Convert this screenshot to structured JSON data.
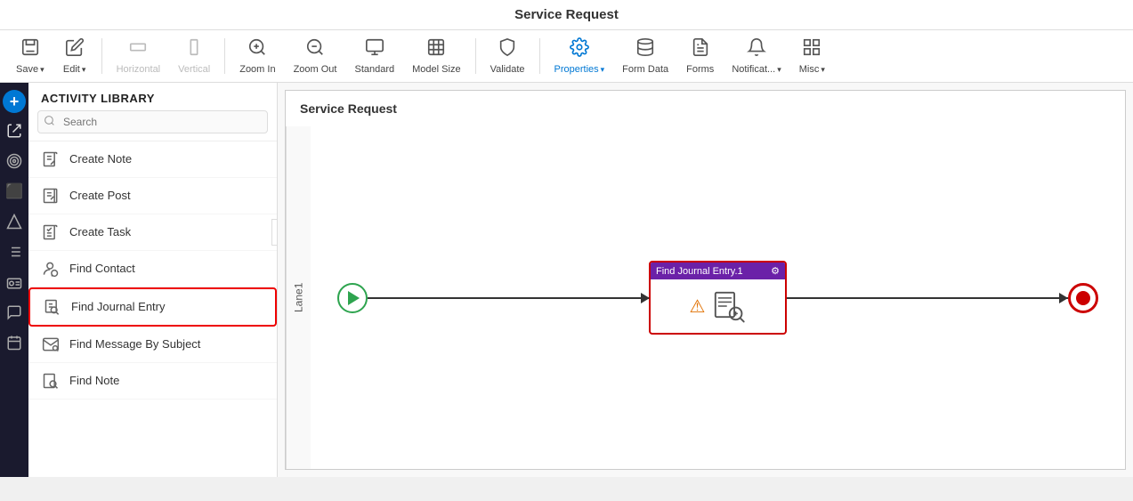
{
  "titleBar": {
    "title": "Service Request"
  },
  "toolbar": {
    "items": [
      {
        "id": "save",
        "label": "Save",
        "icon": "💾",
        "hasDropdown": true,
        "disabled": false,
        "active": false
      },
      {
        "id": "edit",
        "label": "Edit",
        "icon": "✏️",
        "hasDropdown": true,
        "disabled": false,
        "active": false
      },
      {
        "id": "horizontal",
        "label": "Horizontal",
        "icon": "⬛",
        "hasDropdown": false,
        "disabled": true,
        "active": false
      },
      {
        "id": "vertical",
        "label": "Vertical",
        "icon": "🔲",
        "hasDropdown": false,
        "disabled": true,
        "active": false
      },
      {
        "id": "zoom-in",
        "label": "Zoom In",
        "icon": "🔍",
        "hasDropdown": false,
        "disabled": false,
        "active": false
      },
      {
        "id": "zoom-out",
        "label": "Zoom Out",
        "icon": "🔎",
        "hasDropdown": false,
        "disabled": false,
        "active": false
      },
      {
        "id": "standard",
        "label": "Standard",
        "icon": "🖥",
        "hasDropdown": false,
        "disabled": false,
        "active": false
      },
      {
        "id": "model-size",
        "label": "Model Size",
        "icon": "⬜",
        "hasDropdown": false,
        "disabled": false,
        "active": false
      },
      {
        "id": "validate",
        "label": "Validate",
        "icon": "🛡",
        "hasDropdown": false,
        "disabled": false,
        "active": false
      },
      {
        "id": "properties",
        "label": "Properties",
        "icon": "⚙️",
        "hasDropdown": true,
        "disabled": false,
        "active": true
      },
      {
        "id": "form-data",
        "label": "Form Data",
        "icon": "📊",
        "hasDropdown": false,
        "disabled": false,
        "active": false
      },
      {
        "id": "forms",
        "label": "Forms",
        "icon": "📄",
        "hasDropdown": false,
        "disabled": false,
        "active": false
      },
      {
        "id": "notifications",
        "label": "Notificat...",
        "icon": "🔔",
        "hasDropdown": true,
        "disabled": false,
        "active": false
      },
      {
        "id": "misc",
        "label": "Misc",
        "icon": "🗂",
        "hasDropdown": true,
        "disabled": false,
        "active": false
      }
    ]
  },
  "iconRail": {
    "items": [
      {
        "id": "add",
        "icon": "+",
        "active": true,
        "style": "blue"
      },
      {
        "id": "exchange",
        "icon": "⇄",
        "active": false,
        "style": ""
      },
      {
        "id": "target",
        "icon": "◎",
        "active": false,
        "style": ""
      },
      {
        "id": "office",
        "icon": "⬛",
        "active": false,
        "style": "orange"
      },
      {
        "id": "drive",
        "icon": "△",
        "active": false,
        "style": ""
      },
      {
        "id": "list",
        "icon": "≡",
        "active": false,
        "style": ""
      },
      {
        "id": "id-card",
        "icon": "🪪",
        "active": false,
        "style": ""
      },
      {
        "id": "chat",
        "icon": "💬",
        "active": false,
        "style": ""
      },
      {
        "id": "calendar",
        "icon": "📅",
        "active": false,
        "style": ""
      }
    ]
  },
  "sidebar": {
    "header": "Activity Library",
    "search": {
      "placeholder": "Search"
    },
    "items": [
      {
        "id": "create-note",
        "label": "Create Note",
        "icon": "note",
        "selected": false
      },
      {
        "id": "create-post",
        "label": "Create Post",
        "icon": "post",
        "selected": false
      },
      {
        "id": "create-task",
        "label": "Create Task",
        "icon": "task",
        "selected": false
      },
      {
        "id": "find-contact",
        "label": "Find Contact",
        "icon": "contact",
        "selected": false
      },
      {
        "id": "find-journal-entry",
        "label": "Find Journal Entry",
        "icon": "journal",
        "selected": true
      },
      {
        "id": "find-message-by-subject",
        "label": "Find Message By Subject",
        "icon": "message",
        "selected": false
      },
      {
        "id": "find-note",
        "label": "Find Note",
        "icon": "find-note",
        "selected": false
      }
    ]
  },
  "canvas": {
    "label": "Service Request",
    "lane": {
      "label": "Lane1"
    },
    "node": {
      "title": "Find Journal Entry.1",
      "hasSettings": true,
      "hasWarning": true
    }
  }
}
